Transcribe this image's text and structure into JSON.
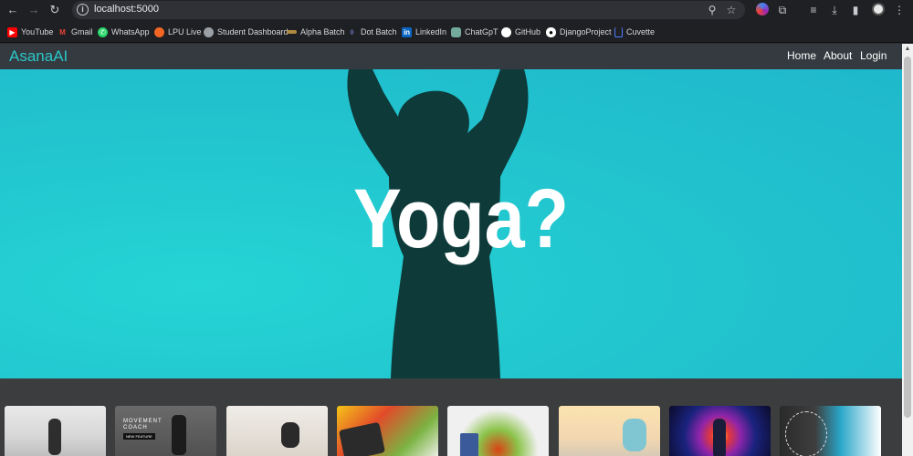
{
  "browser": {
    "url": "localhost:5000",
    "bookmarks": [
      {
        "label": "YouTube",
        "icon": "youtube-icon",
        "color": "#ff0000"
      },
      {
        "label": "Gmail",
        "icon": "gmail-icon",
        "color": "#ea4335"
      },
      {
        "label": "WhatsApp",
        "icon": "whatsapp-icon",
        "color": "#25d366"
      },
      {
        "label": "LPU Live",
        "icon": "lpu-live-icon",
        "color": "#f26522"
      },
      {
        "label": "Student Dashboard",
        "icon": "globe-icon",
        "color": "#9aa0a6"
      },
      {
        "label": "Alpha Batch",
        "icon": "alpha-batch-icon",
        "color": "#b08a3e"
      },
      {
        "label": "Dot Batch",
        "icon": "dot-batch-icon",
        "color": "#7b8cde"
      },
      {
        "label": "LinkedIn",
        "icon": "linkedin-icon",
        "color": "#0a66c2"
      },
      {
        "label": "ChatGpT",
        "icon": "chatgpt-icon",
        "color": "#74aa9c"
      },
      {
        "label": "GitHub",
        "icon": "github-icon",
        "color": "#ffffff"
      },
      {
        "label": "DjangoProject",
        "icon": "django-icon",
        "color": "#ffffff"
      },
      {
        "label": "Cuvette",
        "icon": "cuvette-icon",
        "color": "#4f7cff"
      }
    ]
  },
  "site": {
    "brand": "AsanaAI",
    "nav": [
      "Home",
      "About",
      "Login"
    ],
    "hero_text": "Yoga?",
    "brand_color": "#2cc7c7",
    "hero_color": "#22c6cf"
  },
  "gallery": [
    {
      "alt": "yoga-pose-photo",
      "overlay_title": "",
      "overlay_badge": ""
    },
    {
      "alt": "movement-coach-photo",
      "overlay_title": "MOVEMENT\nCOACH",
      "overlay_badge": "NEW FEATURE"
    },
    {
      "alt": "workout-photo",
      "overlay_title": "",
      "overlay_badge": ""
    },
    {
      "alt": "bmi-food-photo",
      "overlay_title": "",
      "overlay_badge": ""
    },
    {
      "alt": "healthy-food-photo",
      "overlay_title": "",
      "overlay_badge": ""
    },
    {
      "alt": "stretching-photo",
      "overlay_title": "",
      "overlay_badge": ""
    },
    {
      "alt": "chakra-meditation-photo",
      "overlay_title": "",
      "overlay_badge": ""
    },
    {
      "alt": "mind-map-photo",
      "overlay_title": "",
      "overlay_badge": ""
    }
  ]
}
